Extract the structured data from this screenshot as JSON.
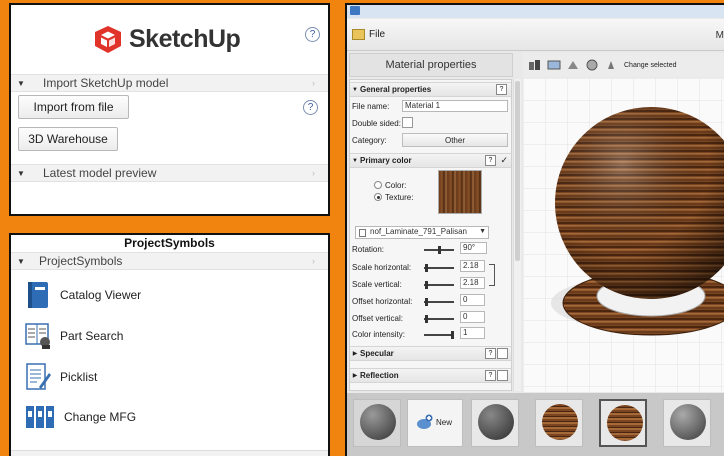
{
  "sketchup_panel": {
    "brand": "SketchUp",
    "help_icon": "?",
    "sections": [
      {
        "label": "Import SketchUp model"
      },
      {
        "label": "Latest model preview"
      }
    ],
    "buttons": {
      "import_from_file": "Import from file",
      "warehouse": "3D Warehouse"
    },
    "brand_color": "#e0342b"
  },
  "project_symbols": {
    "title": "ProjectSymbols",
    "section": "ProjectSymbols",
    "items": [
      {
        "label": "Catalog Viewer",
        "icon": "book-icon"
      },
      {
        "label": "Part Search",
        "icon": "part-search-icon"
      },
      {
        "label": "Picklist",
        "icon": "picklist-icon"
      },
      {
        "label": "Change MFG",
        "icon": "binders-icon"
      }
    ]
  },
  "material_editor": {
    "menu": {
      "file": "File",
      "right_label": "M"
    },
    "left_header": "Material properties",
    "toolbar": {
      "change_selected": "Change selected"
    },
    "general": {
      "title": "General properties",
      "file_name_label": "File name:",
      "file_name_value": "Material 1",
      "double_sided_label": "Double sided:",
      "category_label": "Category:",
      "category_value": "Other"
    },
    "primary_color": {
      "title": "Primary color",
      "color_option": "Color:",
      "texture_option": "Texture:",
      "texture_file": "nof_Laminate_791_Palisan",
      "rotation_label": "Rotation:",
      "rotation_value": "90°",
      "scale_h_label": "Scale horizontal:",
      "scale_h_value": "2.18",
      "scale_v_label": "Scale vertical:",
      "scale_v_value": "2.18",
      "offset_h_label": "Offset horizontal:",
      "offset_h_value": "0",
      "offset_v_label": "Offset vertical:",
      "offset_v_value": "0",
      "intensity_label": "Color intensity:",
      "intensity_value": "1"
    },
    "specular": {
      "title": "Specular"
    },
    "reflection": {
      "title": "Reflection"
    },
    "help": "?",
    "thumbnails": {
      "new_label": "New"
    }
  }
}
